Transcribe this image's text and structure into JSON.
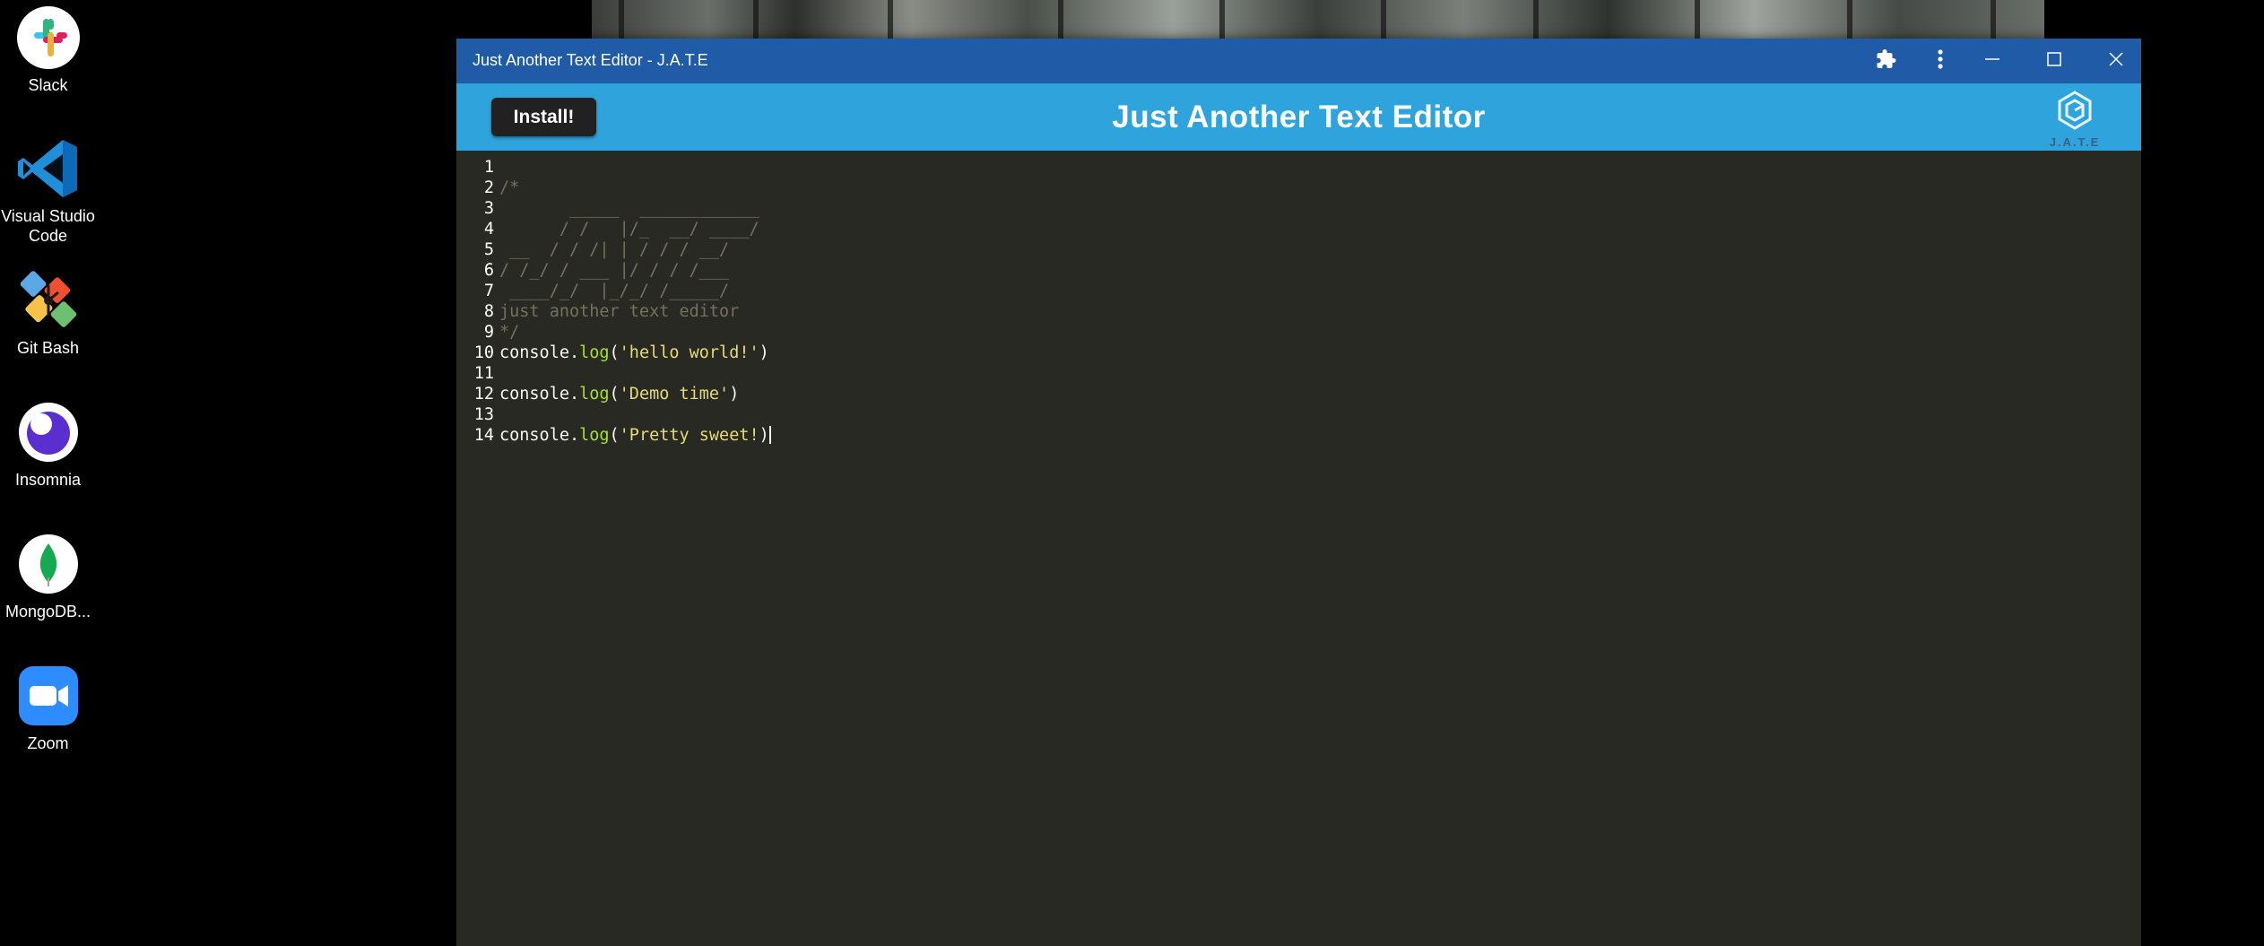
{
  "desktop": {
    "icons": [
      {
        "label": "Slack",
        "icon": "slack-icon"
      },
      {
        "label": "Visual Studio Code",
        "icon": "vscode-icon"
      },
      {
        "label": "Git Bash",
        "icon": "git-bash-icon"
      },
      {
        "label": "Insomnia",
        "icon": "insomnia-icon"
      },
      {
        "label": "MongoDB...",
        "icon": "mongodb-icon"
      },
      {
        "label": "Zoom",
        "icon": "zoom-icon"
      }
    ]
  },
  "window": {
    "title": "Just Another Text Editor - J.A.T.E",
    "controls": [
      "extensions-icon",
      "more-menu-icon",
      "minimize-icon",
      "maximize-icon",
      "close-icon"
    ]
  },
  "app": {
    "install_label": "Install!",
    "title": "Just Another Text Editor",
    "logo_text": "J.A.T.E",
    "accent_color": "#2fa3dc",
    "titlebar_color": "#1f5ba6"
  },
  "editor": {
    "lines": [
      {
        "num": "1",
        "text": ""
      },
      {
        "num": "2",
        "text": "/*"
      },
      {
        "num": "3",
        "text": "       _____  ____________"
      },
      {
        "num": "4",
        "text": "      / /   |/_  __/ ____/"
      },
      {
        "num": "5",
        "text": " __  / / /| | / / / __/"
      },
      {
        "num": "6",
        "text": "/ /_/ / ___ |/ / / /___"
      },
      {
        "num": "7",
        "text": " ____/_/  |_/_/ /_____/"
      },
      {
        "num": "8",
        "text": "just another text editor"
      },
      {
        "num": "9",
        "text": "*/"
      },
      {
        "num": "10",
        "obj": "console.",
        "fn": "log",
        "open": "(",
        "str": "'hello world!'",
        "close": ")"
      },
      {
        "num": "11",
        "text": ""
      },
      {
        "num": "12",
        "obj": "console.",
        "fn": "log",
        "open": "(",
        "str": "'Demo time'",
        "close": ")"
      },
      {
        "num": "13",
        "text": ""
      },
      {
        "num": "14",
        "obj": "console.",
        "fn": "log",
        "open": "(",
        "str": "'Pretty sweet!",
        "close": ")"
      }
    ]
  }
}
